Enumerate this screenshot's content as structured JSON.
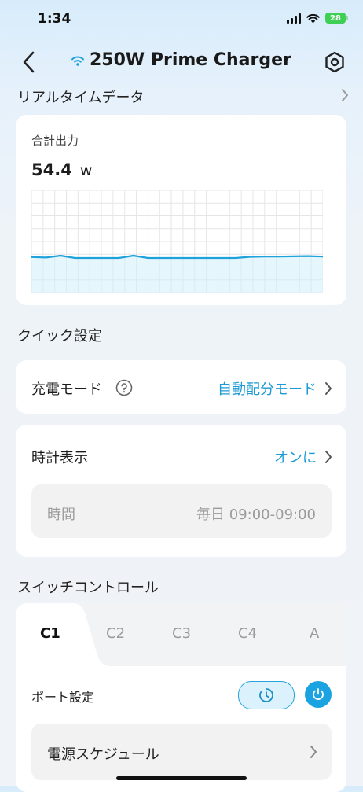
{
  "status_bar": {
    "time": "1:34",
    "battery": "28"
  },
  "header": {
    "title": "250W Prime Charger"
  },
  "realtime": {
    "section_label": "リアルタイムデータ",
    "card_label": "合計出力",
    "value": "54.4",
    "unit": "w",
    "chart_data": {
      "type": "area",
      "x": [
        0,
        1,
        2,
        3,
        4,
        5,
        6,
        7,
        8,
        9,
        10,
        11,
        12,
        13,
        14,
        15,
        16,
        17,
        18,
        19,
        20
      ],
      "values": [
        0.94,
        0.92,
        1.0,
        0.9,
        0.9,
        0.9,
        0.9,
        1.0,
        0.9,
        0.9,
        0.9,
        0.9,
        0.9,
        0.9,
        0.9,
        0.95,
        0.96,
        0.96,
        0.97,
        0.98,
        0.96
      ],
      "grid": true
    }
  },
  "quick_settings": {
    "section_label": "クイック設定",
    "charge_mode_label": "充電モード",
    "charge_mode_value": "自動配分モード",
    "clock_label": "時計表示",
    "clock_value": "オンに",
    "time_label": "時間",
    "time_value": "毎日 09:00-09:00"
  },
  "switch_control": {
    "section_label": "スイッチコントロール",
    "tabs": [
      "C1",
      "C2",
      "C3",
      "C4",
      "A"
    ],
    "port_settings_label": "ポート設定",
    "power_schedule_label": "電源スケジュール"
  },
  "colors": {
    "accent": "#1c9ad6",
    "line": "#1ea2dc"
  },
  "icons": [
    "wifi-icon",
    "back-arrow-icon",
    "hex-settings-icon",
    "chevron-right-icon",
    "help-icon",
    "timer-icon",
    "power-icon"
  ]
}
